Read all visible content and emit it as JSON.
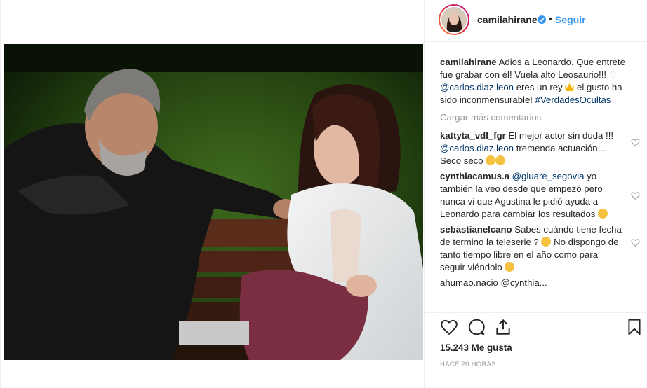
{
  "post": {
    "username": "camilahirane",
    "follow_label": "Seguir",
    "dot": "•",
    "caption": {
      "username": "camilahirane",
      "text_1": " Adios a Leonardo. Que entrete fue grabar con él! Vuela alto Leosaurio!!! ",
      "mention": "@carlos.diaz.leon",
      "text_2": " eres un rey ",
      "text_3": " el gusto ha sido inconmensurable! ",
      "hashtag": "#VerdadesOcultas"
    },
    "load_more_label": "Cargar más comentarios",
    "comments": [
      {
        "username": "kattyta_vdl_fgr",
        "text_1": " El mejor actor sin duda !!! ",
        "mention": "@carlos.diaz.leon",
        "text_2": " tremenda actuación... Seco seco "
      },
      {
        "username": "cynthiacamus.a",
        "text_1": " ",
        "mention": "@gluare_segovia",
        "text_2": " yo también la veo desde que empezó pero nunca vi que Agustina le pidió ayuda a Leonardo para cambiar los resultados "
      },
      {
        "username": "sebastianelcano",
        "text_1": " Sabes cuándo tiene fecha de termino la teleserie ? ",
        "text_2": " No dispongo de tanto tiempo libre en el año como para seguir viéndolo "
      }
    ],
    "truncated_comment": "ahumao.nacio  @cynthia...",
    "likes": "15.243 Me gusta",
    "timestamp": "HACE 20 HORAS"
  },
  "icons": [
    "verified-badge-icon",
    "heart-icon",
    "comment-icon",
    "share-icon",
    "bookmark-icon"
  ],
  "colors": {
    "link": "#3897f0",
    "mention": "#003569",
    "muted": "#999999",
    "text": "#262626",
    "border": "#efefef"
  }
}
